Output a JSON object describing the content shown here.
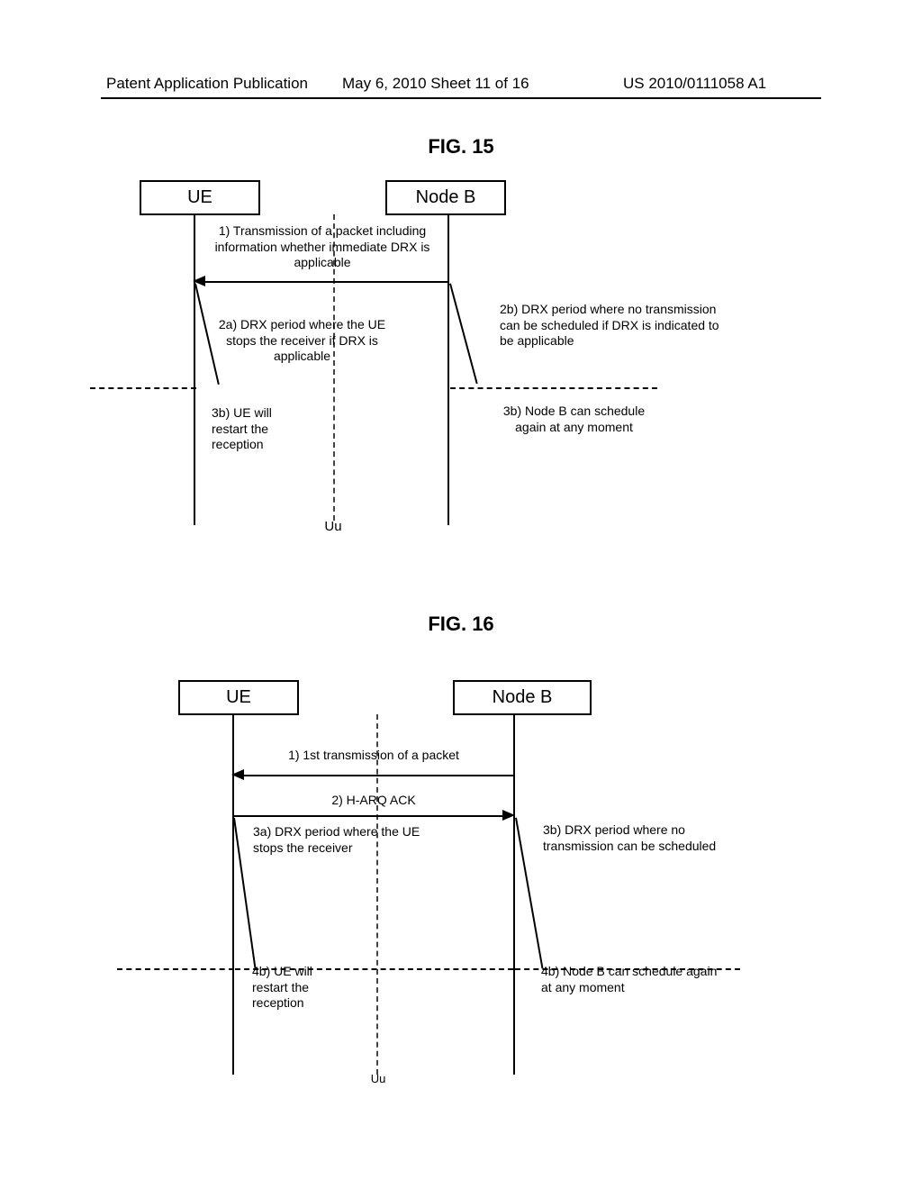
{
  "header": {
    "left": "Patent Application Publication",
    "center": "May 6, 2010  Sheet 11 of 16",
    "right": "US 2010/0111058 A1"
  },
  "fig15": {
    "title": "FIG. 15",
    "ue": "UE",
    "nodeb": "Node B",
    "uu": "Uu",
    "step1": "1) Transmission of a packet including information whether immediate DRX is applicable",
    "step2a": "2a) DRX period where the UE stops the receiver if DRX is applicable",
    "step2b": "2b) DRX period where no transmission can be scheduled if DRX is indicated to be applicable",
    "step3a": "3b) UE will restart the reception",
    "step3b": "3b) Node B can schedule again at any moment"
  },
  "fig16": {
    "title": "FIG. 16",
    "ue": "UE",
    "nodeb": "Node B",
    "uu": "Uu",
    "step1": "1) 1st transmission of a packet",
    "step2": "2) H-ARQ ACK",
    "step3a": "3a) DRX period where the UE stops the receiver",
    "step3b": "3b) DRX period where no transmission can be scheduled",
    "step4a": "4b) UE will restart the reception",
    "step4b": "4b) Node B can schedule again at any moment"
  }
}
